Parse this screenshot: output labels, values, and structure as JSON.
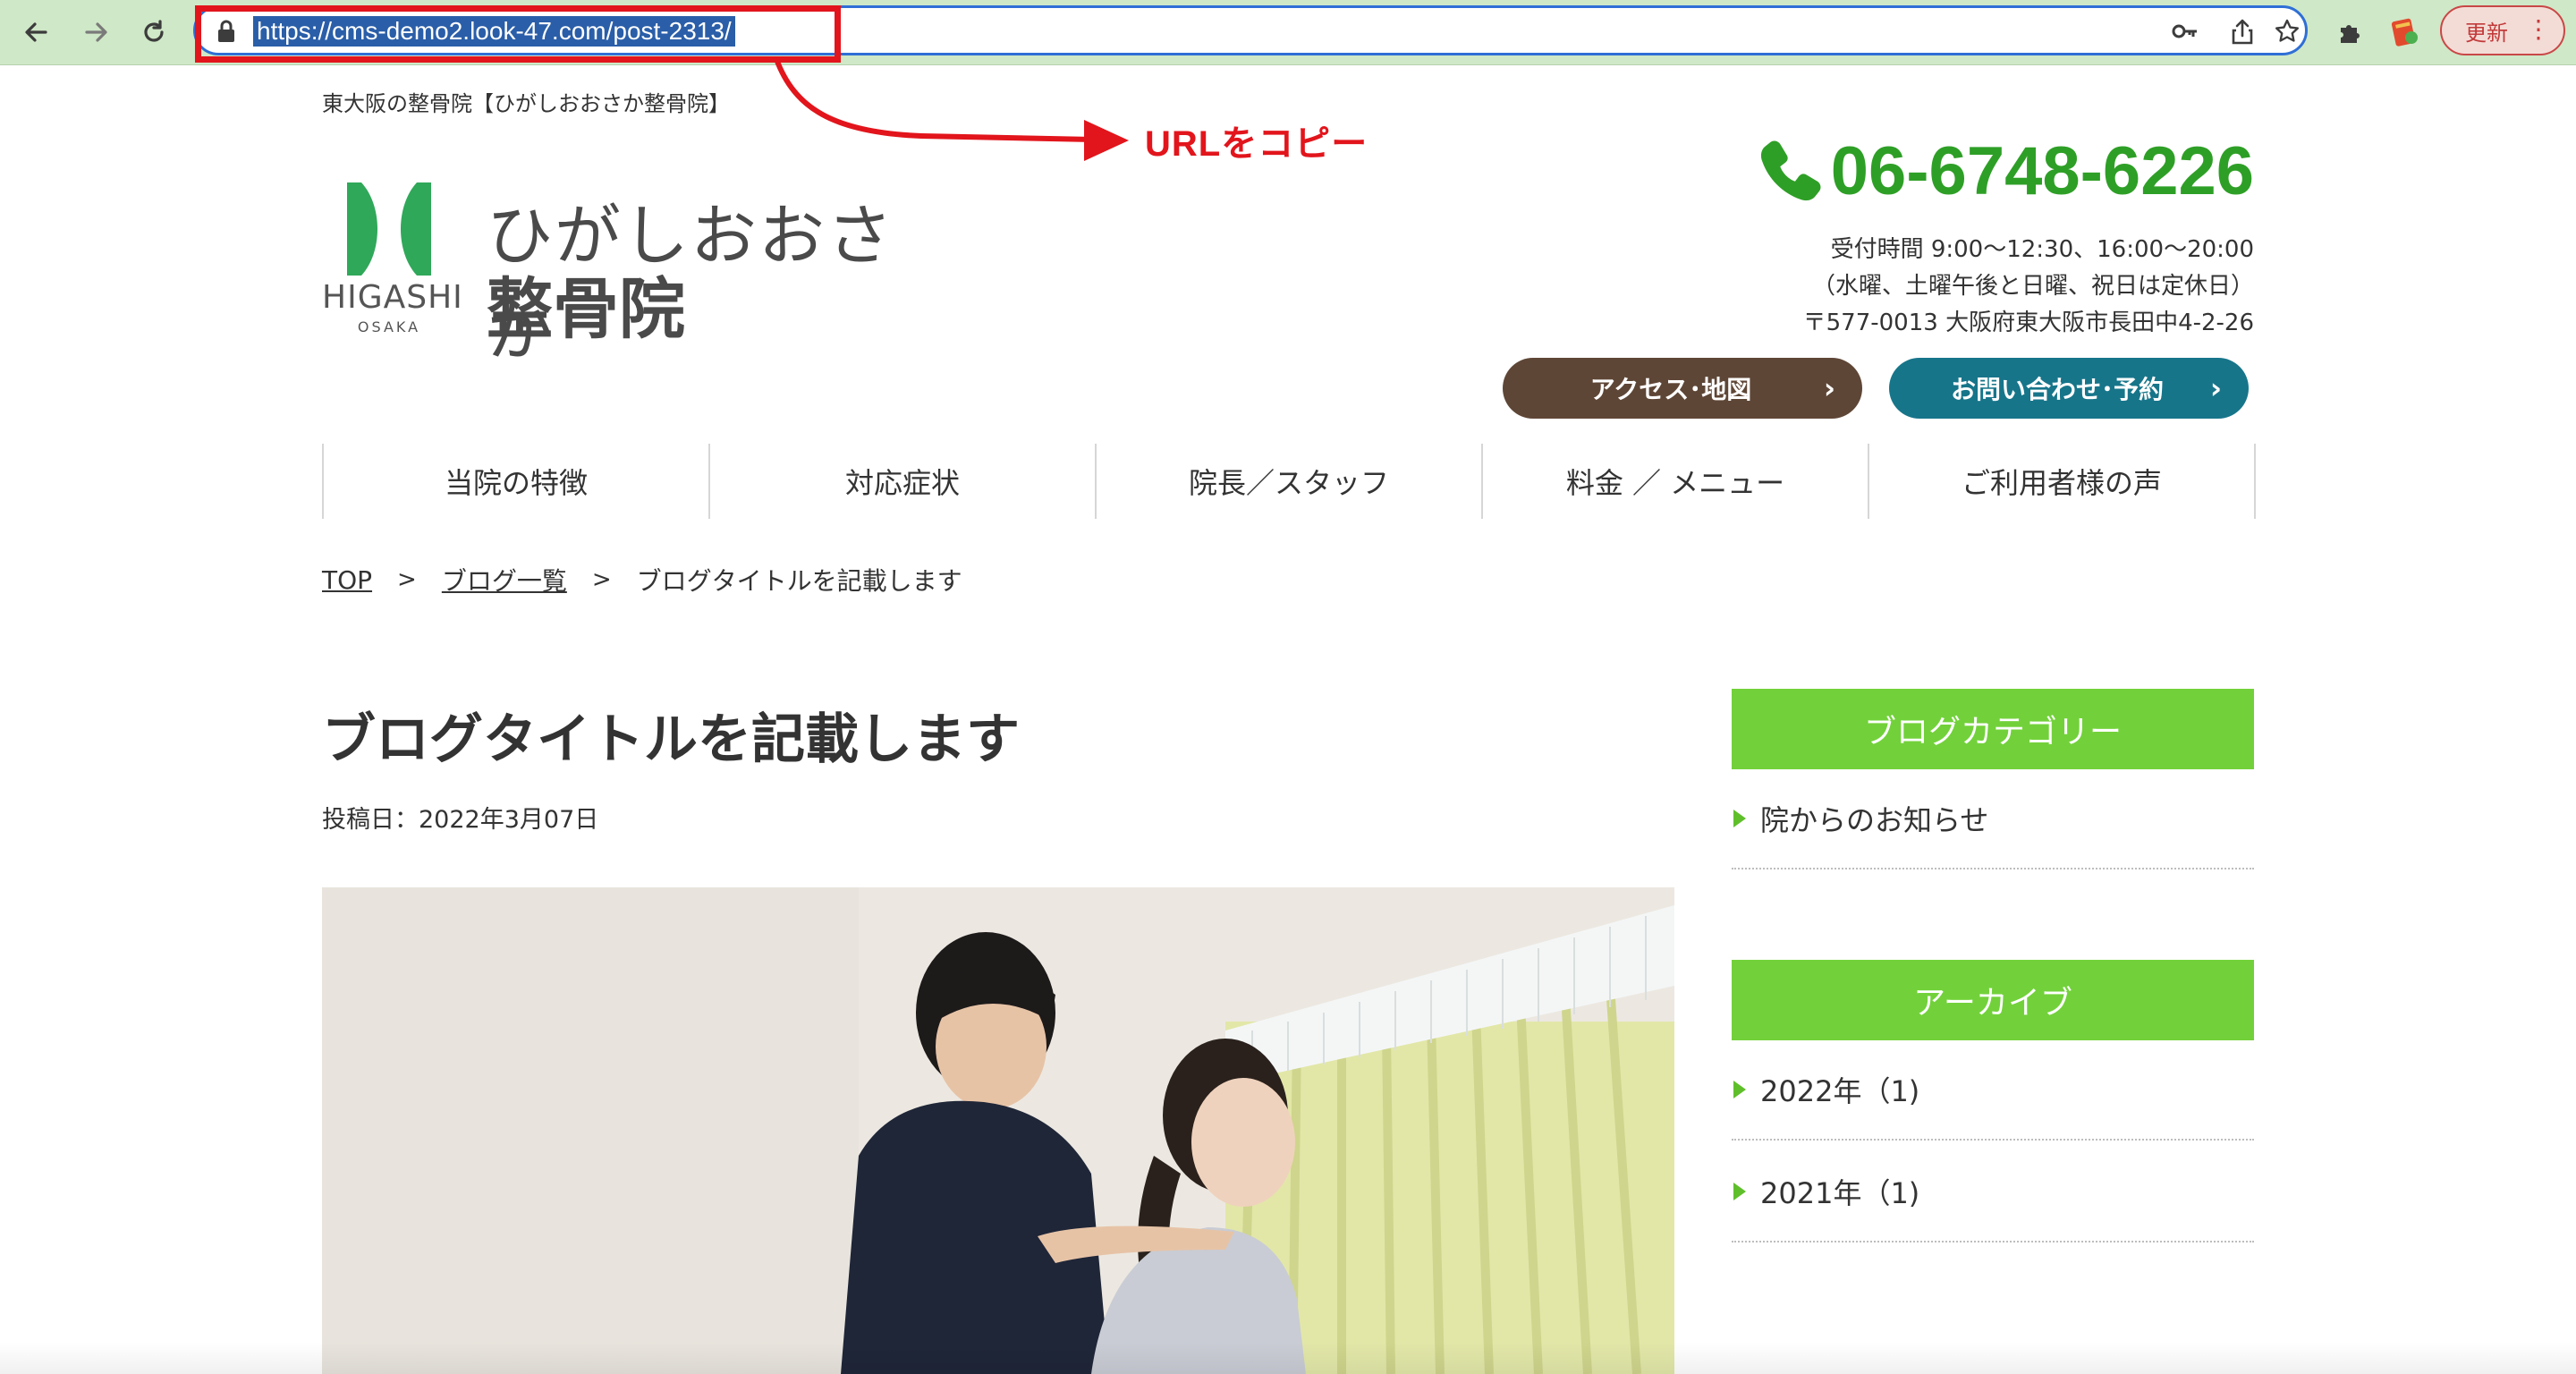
{
  "browser": {
    "url": "https://cms-demo2.look-47.com/post-2313/",
    "update_label": "更新",
    "menu_glyph": "⋮"
  },
  "annotation": {
    "label": "URLをコピー",
    "color": "#e2151c"
  },
  "site": {
    "tagline": "東大阪の整骨院【ひがしおおさか整骨院】",
    "logo": {
      "name_line1": "ひがしおおさか",
      "name_line2": "整骨院",
      "sub_line1": "HIGASHI",
      "sub_line2": "OSAKA",
      "brand_color": "#2fa85a"
    },
    "phone": "06-6748-6226",
    "hours": "受付時間 9:00〜12:30、16:00〜20:00",
    "closed_days": "（水曜、土曜午後と日曜、祝日は定休日）",
    "address": "〒577-0013 大阪府東大阪市長田中4-2-26",
    "buttons": {
      "access": "アクセス･地図",
      "contact": "お問い合わせ･予約"
    },
    "nav": [
      {
        "label": "当院の特徴"
      },
      {
        "label": "対応症状"
      },
      {
        "label": "院長／スタッフ"
      },
      {
        "label": "料金 ／ メニュー"
      },
      {
        "label": "ご利用者様の声"
      }
    ]
  },
  "breadcrumb": {
    "top": "TOP",
    "blog_list": "ブログ一覧",
    "current": "ブログタイトルを記載します",
    "separator": ">"
  },
  "post": {
    "title": "ブログタイトルを記載します",
    "date": "投稿日：2022年3月07日"
  },
  "sidebar": {
    "categories_heading": "ブログカテゴリー",
    "categories": [
      {
        "label": "院からのお知らせ"
      }
    ],
    "archive_heading": "アーカイブ",
    "archives": [
      {
        "label": "2022年（1)"
      },
      {
        "label": "2021年（1)"
      }
    ]
  },
  "colors": {
    "accent_green": "#2e9f26",
    "sidebar_green": "#72d13a",
    "access_brown": "#5e4636",
    "contact_teal": "#17758a"
  }
}
